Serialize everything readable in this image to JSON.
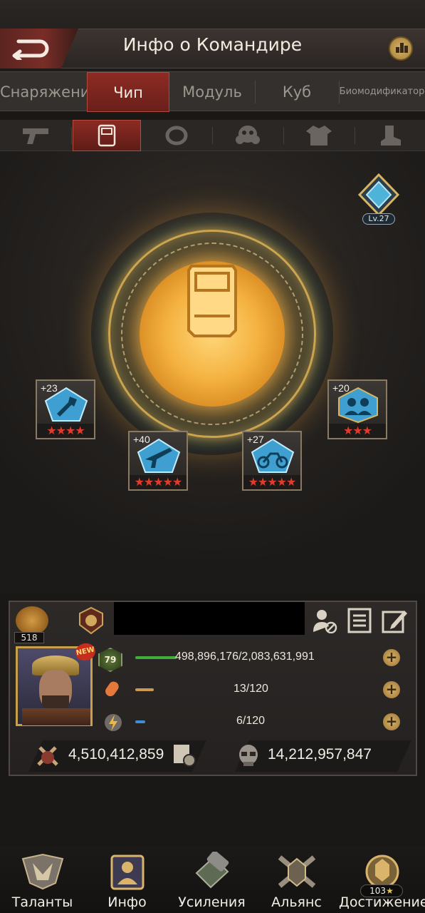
{
  "header": {
    "title": "Инфо о Командире",
    "back_icon": "back-arrow-icon",
    "stats_icon": "stats-icon"
  },
  "tabs": [
    {
      "label": "Снаряжение",
      "active": false
    },
    {
      "label": "Чип",
      "active": true
    },
    {
      "label": "Модуль",
      "active": false
    },
    {
      "label": "Куб",
      "active": false
    },
    {
      "label": "Биомодификатор",
      "active": false
    }
  ],
  "subtabs": [
    {
      "icon": "pistol-icon",
      "active": false
    },
    {
      "icon": "chip-icon",
      "active": true
    },
    {
      "icon": "ring-icon",
      "active": false
    },
    {
      "icon": "gas-mask-icon",
      "active": false
    },
    {
      "icon": "armor-icon",
      "active": false
    },
    {
      "icon": "boot-icon",
      "active": false
    }
  ],
  "chip": {
    "level_label": "Lv.27"
  },
  "slots": [
    {
      "bonus": "+23",
      "stars": 4,
      "icon": "wrench-icon"
    },
    {
      "bonus": "+20",
      "stars": 3,
      "icon": "group-icon"
    },
    {
      "bonus": "+40",
      "stars": 5,
      "icon": "rifle-icon"
    },
    {
      "bonus": "+27",
      "stars": 5,
      "icon": "motorcycle-icon"
    }
  ],
  "commander": {
    "power_level": "518",
    "level": "79",
    "new_badge": "NEW",
    "exp_text": "498,896,176/2,083,631,991",
    "exp_fill": 0.24,
    "stamina_text": "13/120",
    "stamina_fill": 0.108,
    "energy_text": "6/120",
    "energy_fill": 0.05,
    "power_value": "4,510,412,859",
    "kills_value": "14,212,957,847"
  },
  "colors": {
    "accent_red": "#8d2b24",
    "gold": "#d9b46a",
    "exp_bar": "#3fae3a",
    "stamina_bar": "#c99a52",
    "energy_bar": "#3c8fd6"
  },
  "nav": [
    {
      "label": "Таланты",
      "icon": "talents-icon"
    },
    {
      "label": "Инфо",
      "icon": "info-icon"
    },
    {
      "label": "Усиления",
      "icon": "boosts-icon"
    },
    {
      "label": "Альянс",
      "icon": "alliance-icon"
    },
    {
      "label": "Достижение",
      "icon": "achievement-icon",
      "count": "103"
    }
  ]
}
